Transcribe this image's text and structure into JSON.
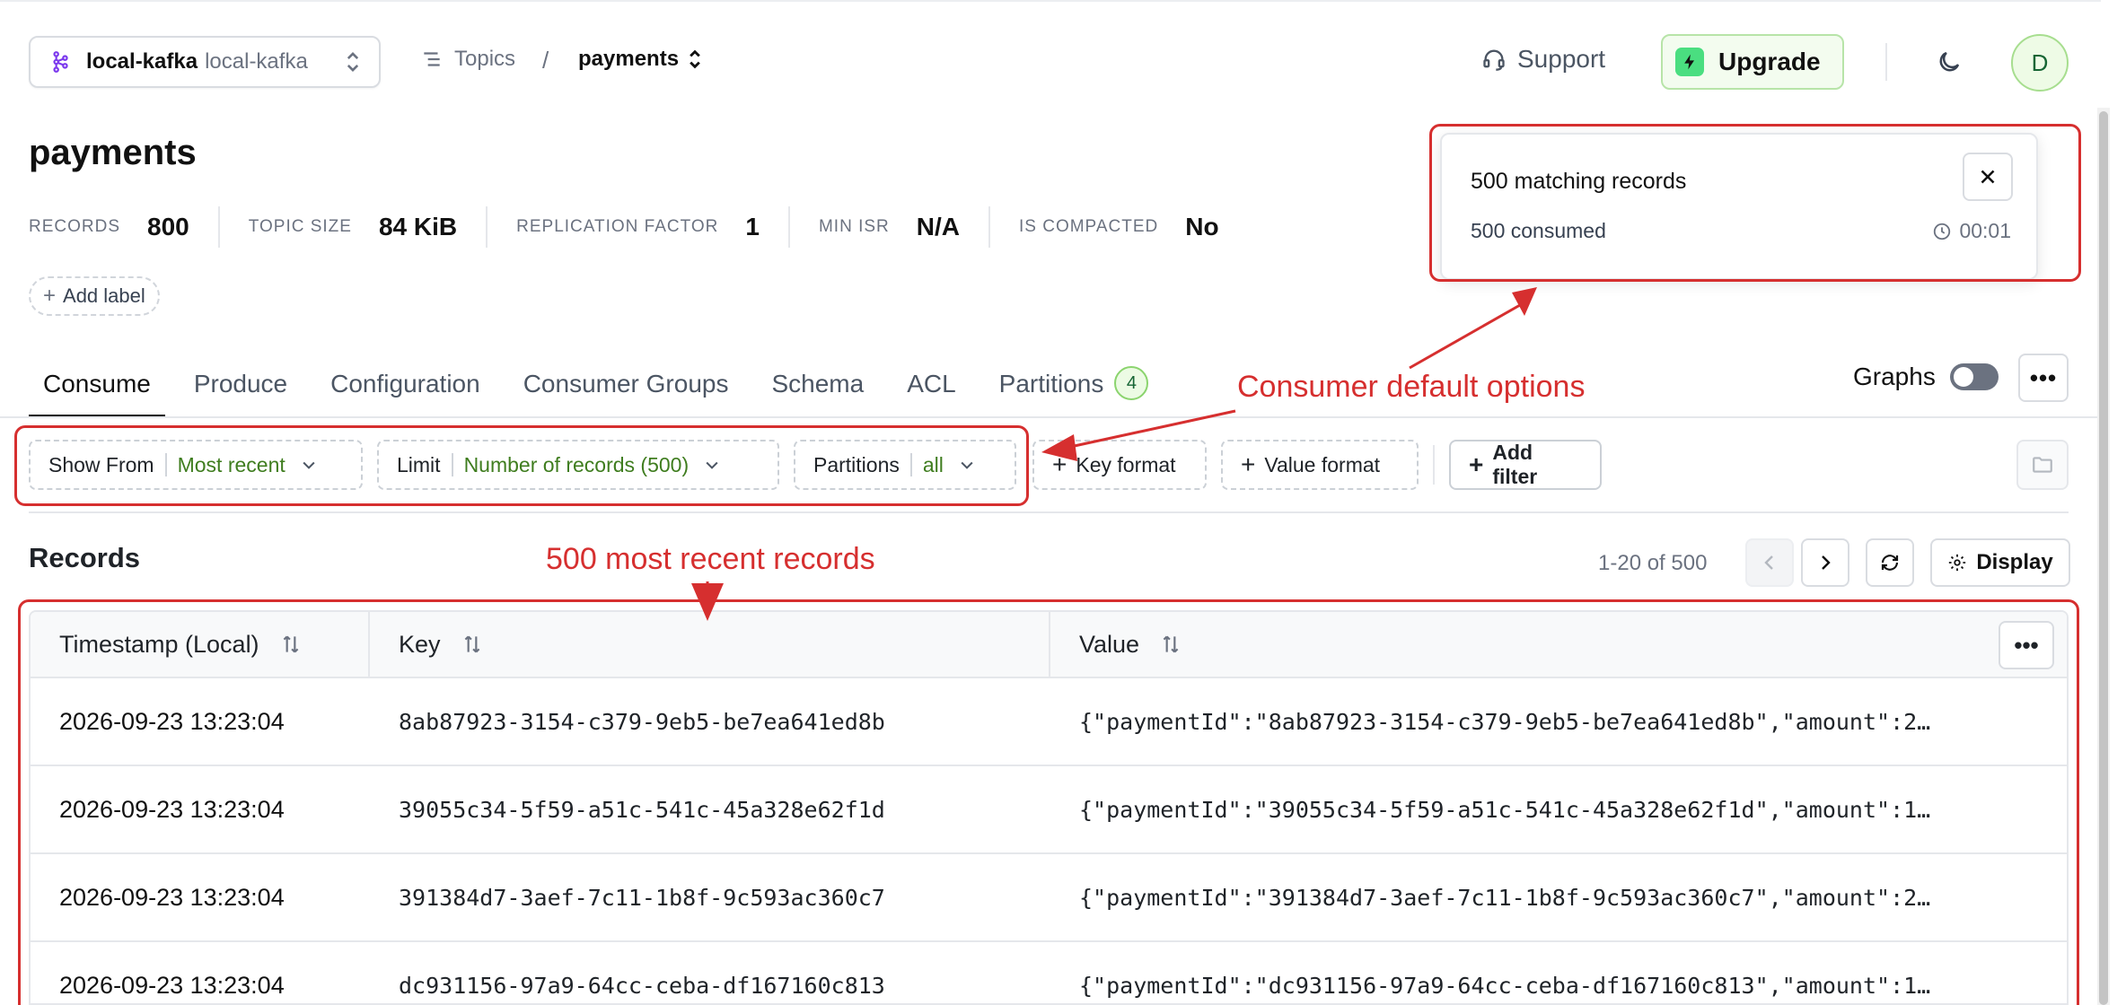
{
  "topbar": {
    "cluster_name": "local-kafka",
    "cluster_sub": "local-kafka",
    "breadcrumb_topics": "Topics",
    "breadcrumb_sep": "/",
    "breadcrumb_current": "payments",
    "support_label": "Support",
    "upgrade_label": "Upgrade",
    "avatar_initial": "D"
  },
  "page": {
    "title": "payments",
    "stats": [
      {
        "label": "RECORDS",
        "value": "800"
      },
      {
        "label": "TOPIC SIZE",
        "value": "84 KiB"
      },
      {
        "label": "REPLICATION FACTOR",
        "value": "1"
      },
      {
        "label": "MIN ISR",
        "value": "N/A"
      },
      {
        "label": "IS COMPACTED",
        "value": "No"
      }
    ],
    "add_label": "Add label"
  },
  "tabs": {
    "items": [
      "Consume",
      "Produce",
      "Configuration",
      "Consumer Groups",
      "Schema",
      "ACL",
      "Partitions"
    ],
    "partitions_badge": "4",
    "active": "Consume",
    "graphs_label": "Graphs"
  },
  "filters": {
    "show_from_label": "Show From",
    "show_from_value": "Most recent",
    "limit_label": "Limit",
    "limit_value": "Number of records (500)",
    "partitions_label": "Partitions",
    "partitions_value": "all",
    "key_format": "Key format",
    "value_format": "Value format",
    "add_filter": "Add filter"
  },
  "records": {
    "title": "Records",
    "pager_text": "1-20 of 500",
    "display_label": "Display",
    "columns": [
      "Timestamp (Local)",
      "Key",
      "Value"
    ],
    "rows": [
      {
        "ts": "2026-09-23 13:23:04",
        "key": "8ab87923-3154-c379-9eb5-be7ea641ed8b",
        "value": "{\"paymentId\":\"8ab87923-3154-c379-9eb5-be7ea641ed8b\",\"amount\":2…"
      },
      {
        "ts": "2026-09-23 13:23:04",
        "key": "39055c34-5f59-a51c-541c-45a328e62f1d",
        "value": "{\"paymentId\":\"39055c34-5f59-a51c-541c-45a328e62f1d\",\"amount\":1…"
      },
      {
        "ts": "2026-09-23 13:23:04",
        "key": "391384d7-3aef-7c11-1b8f-9c593ac360c7",
        "value": "{\"paymentId\":\"391384d7-3aef-7c11-1b8f-9c593ac360c7\",\"amount\":2…"
      },
      {
        "ts": "2026-09-23 13:23:04",
        "key": "dc931156-97a9-64cc-ceba-df167160c813",
        "value": "{\"paymentId\":\"dc931156-97a9-64cc-ceba-df167160c813\",\"amount\":1…"
      }
    ]
  },
  "popup": {
    "title": "500 matching records",
    "consumed": "500 consumed",
    "elapsed": "00:01"
  },
  "annotations": {
    "consumer_defaults": "Consumer default options",
    "recent_records": "500 most recent records",
    "color": "#d62f2f"
  },
  "colors": {
    "accent_green": "#3f7d1f",
    "upgrade_bg": "#f3fcef",
    "brand_purple": "#7c3aed"
  }
}
